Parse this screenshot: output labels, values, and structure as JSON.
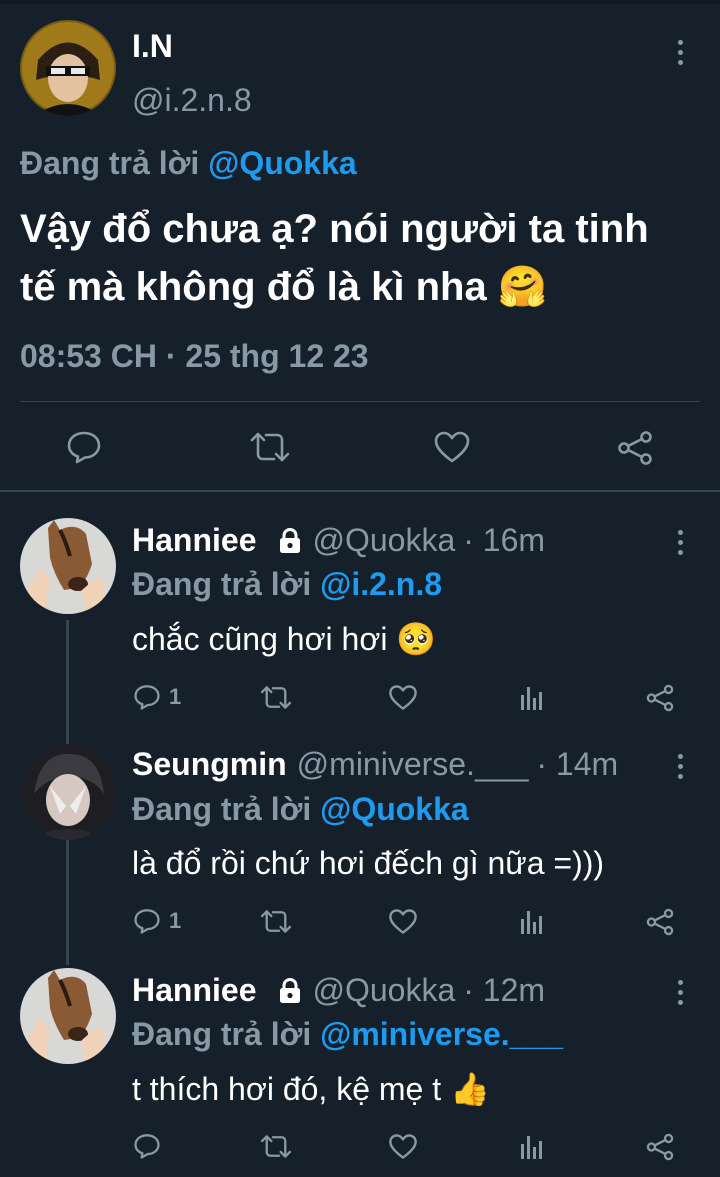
{
  "colors": {
    "background": "#15202b",
    "text_primary": "#ffffff",
    "text_muted": "#8899a6",
    "link": "#1d9bf0",
    "divider": "#38444d"
  },
  "main_tweet": {
    "display_name": "I.N",
    "handle": "@i.2.n.8",
    "replying_to_label": "Đang trả lời",
    "replying_to_handle": "@Quokka",
    "text_line1": "Vậy đổ chưa ạ? nói người ta tinh",
    "text_line2": "tế mà không đổ là kì nha",
    "text_emoji": "🤗",
    "timestamp": "08:53 CH · 25 thg 12 23",
    "actions": [
      "reply-icon",
      "retweet-icon",
      "like-icon",
      "share-icon"
    ]
  },
  "replies": [
    {
      "display_name": "Hanniee",
      "locked": true,
      "handle": "@Quokka",
      "time": "· 16m",
      "replying_to_label": "Đang trả lời",
      "replying_to_handle": "@i.2.n.8",
      "text": "chắc cũng hơi hơi",
      "emoji": "🥺",
      "reply_count": "1"
    },
    {
      "display_name": "Seungmin",
      "locked": false,
      "handle": "@miniverse.___",
      "time": "· 14m",
      "replying_to_label": "Đang trả lời",
      "replying_to_handle": "@Quokka",
      "text": "là đổ rồi chứ hơi đếch gì nữa =)))",
      "emoji": "",
      "reply_count": "1"
    },
    {
      "display_name": "Hanniee",
      "locked": true,
      "handle": "@Quokka",
      "time": "· 12m",
      "replying_to_label": "Đang trả lời",
      "replying_to_handle": "@miniverse.___",
      "text": "t thích hơi đó, kệ mẹ t",
      "emoji": "👍",
      "reply_count": ""
    }
  ]
}
